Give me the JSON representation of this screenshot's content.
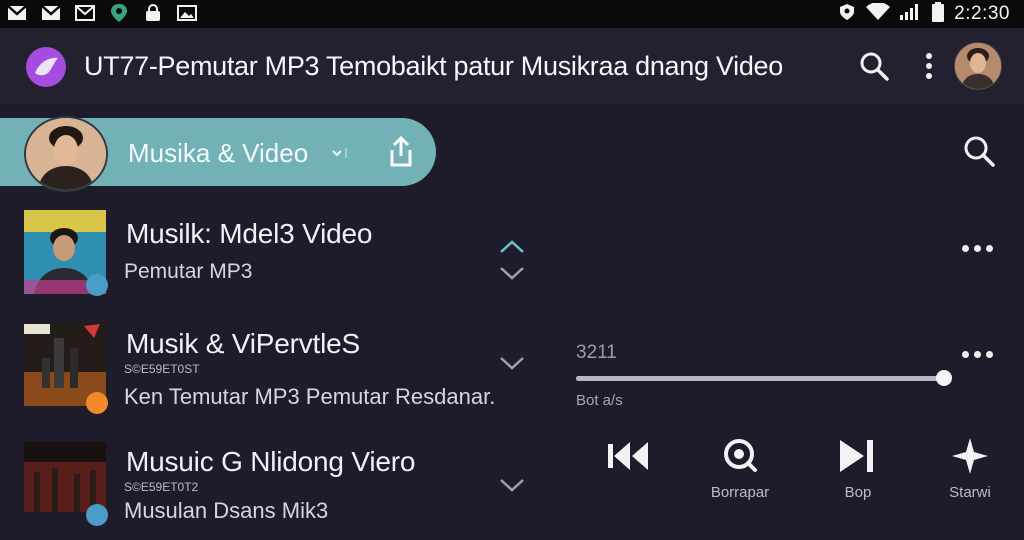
{
  "status_bar": {
    "time": "2:2:30",
    "left_icons": [
      "gmail-icon",
      "gmail-icon",
      "gmail-icon",
      "maps-icon",
      "lock-icon",
      "image-icon"
    ],
    "right_icons": [
      "vpn-icon",
      "wifi-icon",
      "signal-icon",
      "battery-icon"
    ]
  },
  "app_bar": {
    "title": "UT77-Pemutar MP3 Temobaikt patur Musikraa dnang Video",
    "logo_icon": "app-logo-icon",
    "actions": [
      "search-icon",
      "more-vertical-icon",
      "avatar"
    ]
  },
  "playlist_pill": {
    "label": "Musika  & Video",
    "dropdown_icon": "chevron-down-icon",
    "share_icon": "share-icon",
    "color": "#72b1b6"
  },
  "list": {
    "items": [
      {
        "title": "Musilk: Mdel3 Video",
        "subtitle": "Pemutar MP3",
        "meta": ""
      },
      {
        "title": "Musik & ViPervtleS",
        "subtitle": "Ken Temutar MP3  Pemutar Resdanar.",
        "meta": "S©E59ET0ST"
      },
      {
        "title": "Musuic G Nlidong Viero",
        "subtitle": "Musulan Dsans Mik3",
        "meta": "S©E59ET0T2"
      }
    ]
  },
  "player": {
    "time": "3211",
    "status": "Bot a/s",
    "progress": 1.0,
    "controls": [
      {
        "icon": "rewind-icon",
        "label": ""
      },
      {
        "icon": "search-icon",
        "label": "Borrapar"
      },
      {
        "icon": "skip-next-icon",
        "label": "Bop"
      },
      {
        "icon": "sparkle-icon",
        "label": "Starwi"
      }
    ]
  },
  "colors": {
    "background": "#1e1c2a",
    "app_bar": "#232130",
    "status_bar": "#0a0a0c",
    "accent_logo": "#a64ddf",
    "chevron_teal": "#69c3c6",
    "badge_blue": "#4a9dc8",
    "badge_orange": "#f08a2c"
  }
}
